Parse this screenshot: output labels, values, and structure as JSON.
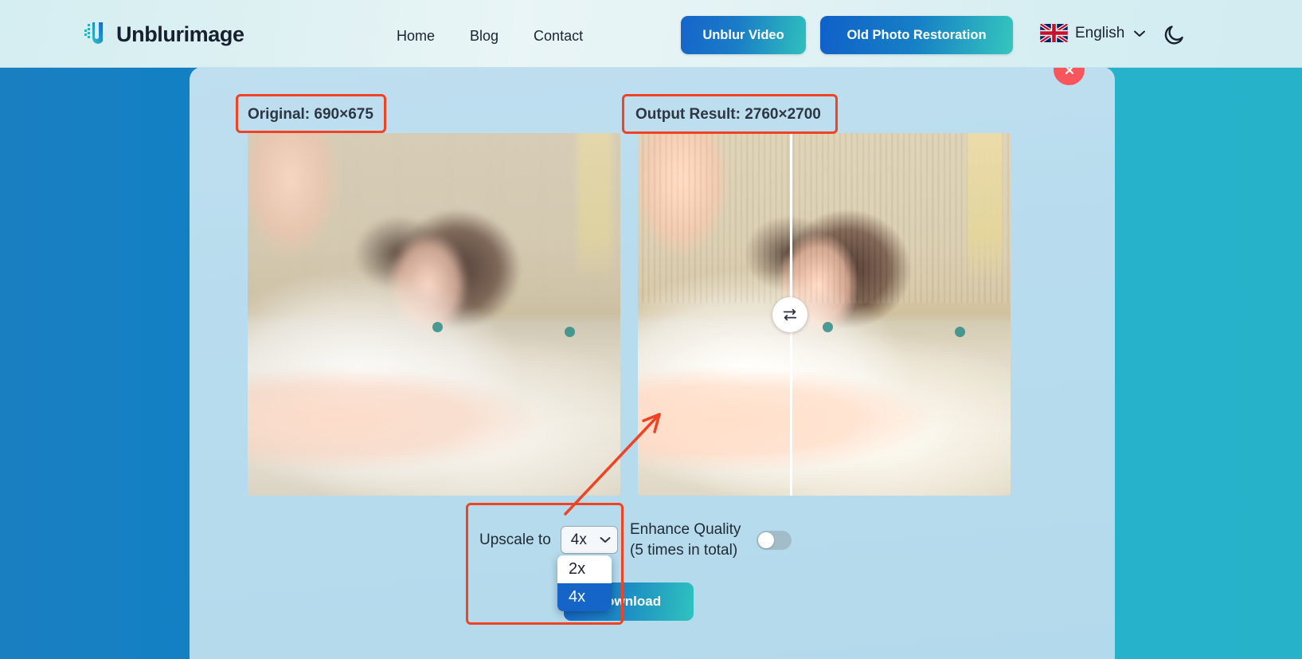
{
  "header": {
    "logo_text": "Unblurimage",
    "logo_icon": "unblurimage-logo-icon",
    "nav": [
      {
        "label": "Home"
      },
      {
        "label": "Blog"
      },
      {
        "label": "Contact"
      }
    ],
    "cta": {
      "unblur_video": "Unblur Video",
      "old_photo_restoration": "Old Photo Restoration"
    },
    "language": {
      "label": "English",
      "flag_icon": "uk-flag-icon",
      "chevron_icon": "chevron-down-icon"
    },
    "theme_toggle_icon": "moon-icon"
  },
  "panel": {
    "close_badge_icon": "close-icon",
    "original": {
      "label": "Original:",
      "dimensions": "690×675",
      "full": "Original:  690×675"
    },
    "output": {
      "label": "Output Result:",
      "dimensions": "2760×2700",
      "full": "Output Result:  2760×2700"
    },
    "compare_handle_icon": "swap-horizontal-icon"
  },
  "controls": {
    "upscale_label": "Upscale to",
    "upscale_value": "4x",
    "upscale_chevron_icon": "chevron-down-icon",
    "upscale_options": [
      {
        "label": "2x",
        "selected": false
      },
      {
        "label": "4x",
        "selected": true
      }
    ],
    "enhance_line1": "Enhance Quality",
    "enhance_line2": "(5 times in total)",
    "enhance_enabled": false,
    "download_label": "Download"
  },
  "colors": {
    "accent_blue": "#1565c9",
    "accent_teal": "#2fc3be",
    "page_left": "#1380c4",
    "page_right": "#25b1c9",
    "panel_bg": "#b8dcee",
    "annotation_red": "#ef4323",
    "badge_red": "#f9555c",
    "option_selected": "#1565c9"
  }
}
